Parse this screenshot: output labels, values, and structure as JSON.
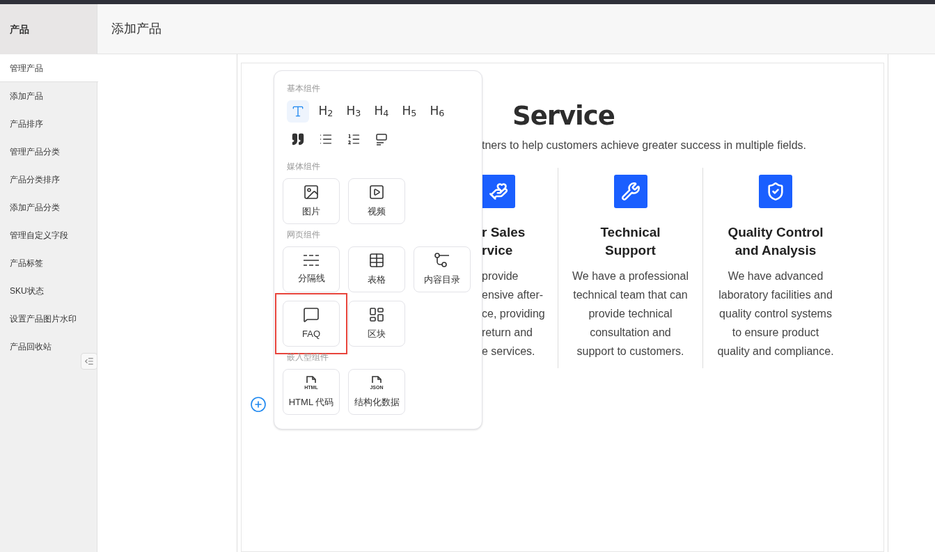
{
  "sidebar": {
    "title": "产品",
    "items": [
      {
        "label": "管理产品",
        "selected": true
      },
      {
        "label": "添加产品",
        "selected": false
      },
      {
        "label": "产品排序",
        "selected": false
      },
      {
        "label": "管理产品分类",
        "selected": false
      },
      {
        "label": "产品分类排序",
        "selected": false
      },
      {
        "label": "添加产品分类",
        "selected": false
      },
      {
        "label": "管理自定义字段",
        "selected": false
      },
      {
        "label": "产品标签",
        "selected": false
      },
      {
        "label": "SKU状态",
        "selected": false
      },
      {
        "label": "设置产品图片水印",
        "selected": false
      },
      {
        "label": "产品回收站",
        "selected": false
      }
    ]
  },
  "page_title": "添加产品",
  "content": {
    "heading": "Service",
    "subtitle": "tners to help customers achieve greater success in multiple fields.",
    "cards": [
      {
        "kind": "care",
        "title": [
          "r Sales",
          "rvice"
        ],
        "lines": [
          "provide",
          "ensive after-",
          "ce, providing",
          "return and",
          "e services."
        ]
      },
      {
        "kind": "tools",
        "title": [
          "Technical",
          "Support"
        ],
        "lines": [
          "We have a professional",
          "technical team that can",
          "provide technical",
          "consultation and",
          "support to customers."
        ]
      },
      {
        "kind": "quality",
        "title": [
          "Quality Control",
          "and Analysis"
        ],
        "lines": [
          "We have advanced",
          "laboratory facilities and",
          "quality control systems",
          "to ensure product",
          "quality and compliance."
        ]
      }
    ]
  },
  "component_menu": {
    "sections": [
      {
        "title": "基本组件",
        "kind": "icons",
        "items": [
          {
            "kind": "text",
            "selected": true
          },
          {
            "kind": "heading",
            "label": "H$_{2}$",
            "selected": false
          },
          {
            "kind": "heading",
            "label": "H$_{3}$",
            "selected": false
          },
          {
            "kind": "heading",
            "label": "H$_{4}$",
            "selected": false
          },
          {
            "kind": "heading",
            "label": "H$_{5}$",
            "selected": false
          },
          {
            "kind": "heading",
            "label": "H$_{6}$",
            "selected": false
          },
          {
            "kind": "quote",
            "selected": false
          },
          {
            "kind": "bullets",
            "selected": false
          },
          {
            "kind": "numbers",
            "selected": false
          },
          {
            "kind": "callout",
            "selected": false
          }
        ]
      },
      {
        "title": "媒体组件",
        "kind": "tiles",
        "items": [
          {
            "kind": "image",
            "label": "图片",
            "highlighted": false
          },
          {
            "kind": "video",
            "label": "视频",
            "highlighted": false
          }
        ]
      },
      {
        "title": "网页组件",
        "kind": "tiles",
        "items": [
          {
            "kind": "divider",
            "label": "分隔线",
            "highlighted": false
          },
          {
            "kind": "table",
            "label": "表格",
            "highlighted": false
          },
          {
            "kind": "toc",
            "label": "内容目录",
            "highlighted": false
          },
          {
            "kind": "chat",
            "label": "FAQ",
            "highlighted": true
          },
          {
            "kind": "blocks",
            "label": "区块",
            "highlighted": false
          }
        ]
      },
      {
        "title": "嵌入型组件",
        "kind": "tiles",
        "items": [
          {
            "kind": "file",
            "tag": "HTML",
            "label": "HTML 代码",
            "highlighted": false
          },
          {
            "kind": "file",
            "tag": "JSON",
            "label": "结构化数据",
            "highlighted": false
          }
        ]
      }
    ]
  }
}
